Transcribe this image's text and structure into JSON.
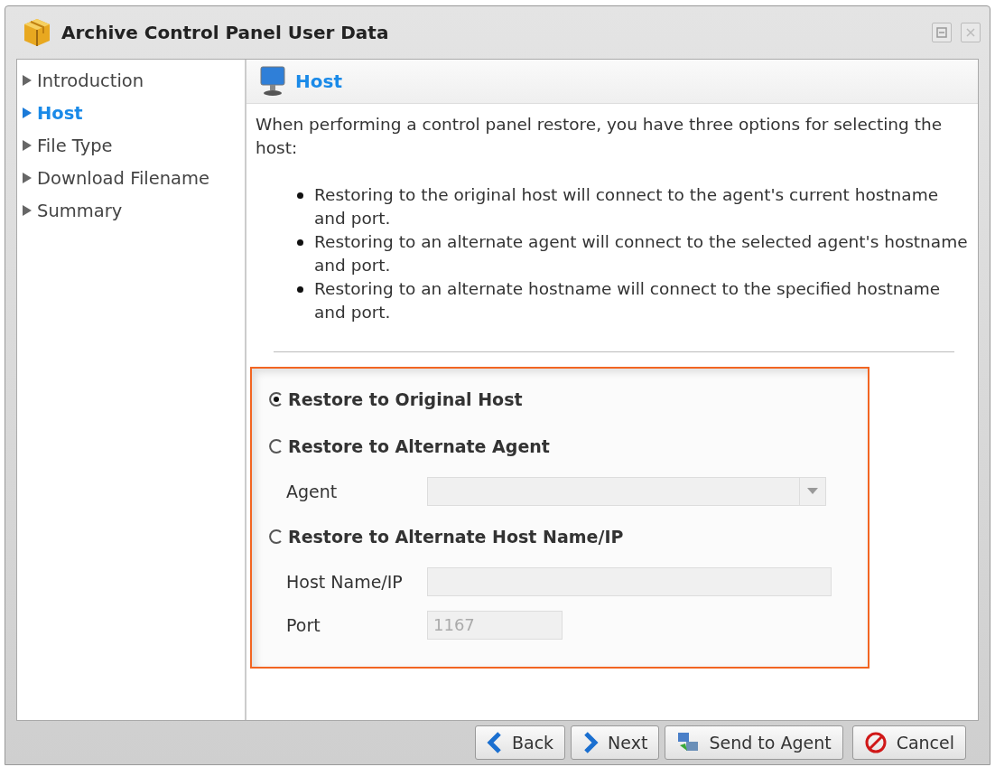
{
  "window": {
    "title": "Archive Control Panel User Data"
  },
  "sidebar": {
    "items": [
      {
        "label": "Introduction",
        "selected": false
      },
      {
        "label": "Host",
        "selected": true
      },
      {
        "label": "File Type",
        "selected": false
      },
      {
        "label": "Download Filename",
        "selected": false
      },
      {
        "label": "Summary",
        "selected": false
      }
    ]
  },
  "panel": {
    "title": "Host",
    "intro": "When performing a control panel restore, you have three options for selecting the host:",
    "bullets": [
      "Restoring to the original host will connect to the agent's current hostname and port.",
      "Restoring to an alternate agent will connect to the selected agent's hostname and port.",
      "Restoring to an alternate hostname will connect to the specified hostname and port."
    ],
    "options": [
      {
        "label": "Restore to Original Host",
        "selected": true
      },
      {
        "label": "Restore to Alternate Agent",
        "selected": false,
        "fields": [
          {
            "kind": "select",
            "label": "Agent",
            "disabled": true
          }
        ]
      },
      {
        "label": "Restore to Alternate Host Name/IP",
        "selected": false,
        "fields": [
          {
            "kind": "text",
            "label": "Host Name/IP",
            "disabled": true
          },
          {
            "kind": "short",
            "label": "Port",
            "value": "1167",
            "disabled": true
          }
        ]
      }
    ]
  },
  "buttons": [
    {
      "kind": "back",
      "label": "Back"
    },
    {
      "kind": "next",
      "label": "Next"
    },
    {
      "kind": "send",
      "label": "Send to Agent"
    },
    {
      "kind": "cancel",
      "label": "Cancel"
    }
  ]
}
